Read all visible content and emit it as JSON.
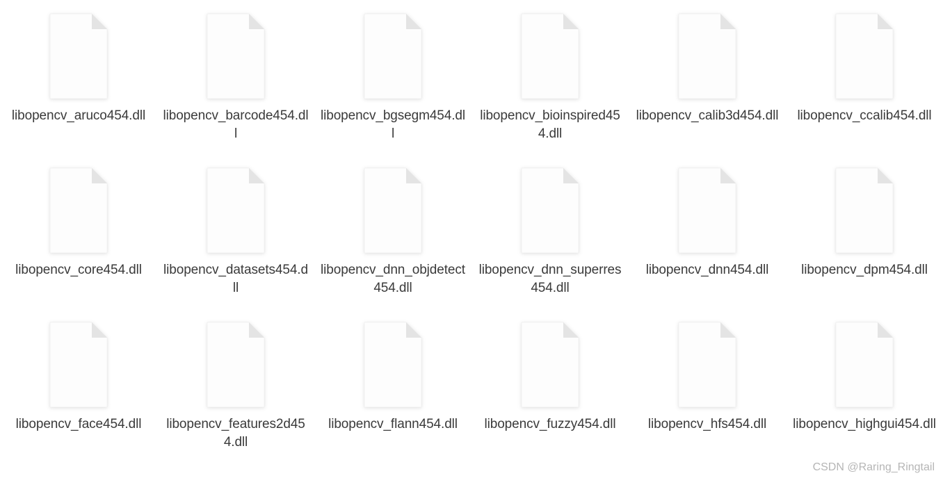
{
  "files": [
    {
      "label": "libopencv_aruco454.dll"
    },
    {
      "label": "libopencv_barcode454.dll"
    },
    {
      "label": "libopencv_bgsegm454.dll"
    },
    {
      "label": "libopencv_bioinspired454.dll"
    },
    {
      "label": "libopencv_calib3d454.dll"
    },
    {
      "label": "libopencv_ccalib454.dll"
    },
    {
      "label": "libopencv_core454.dll"
    },
    {
      "label": "libopencv_datasets454.dll"
    },
    {
      "label": "libopencv_dnn_objdetect454.dll"
    },
    {
      "label": "libopencv_dnn_superres454.dll"
    },
    {
      "label": "libopencv_dnn454.dll"
    },
    {
      "label": "libopencv_dpm454.dll"
    },
    {
      "label": "libopencv_face454.dll"
    },
    {
      "label": "libopencv_features2d454.dll"
    },
    {
      "label": "libopencv_flann454.dll"
    },
    {
      "label": "libopencv_fuzzy454.dll"
    },
    {
      "label": "libopencv_hfs454.dll"
    },
    {
      "label": "libopencv_highgui454.dll"
    }
  ],
  "watermark": "CSDN @Raring_Ringtail"
}
